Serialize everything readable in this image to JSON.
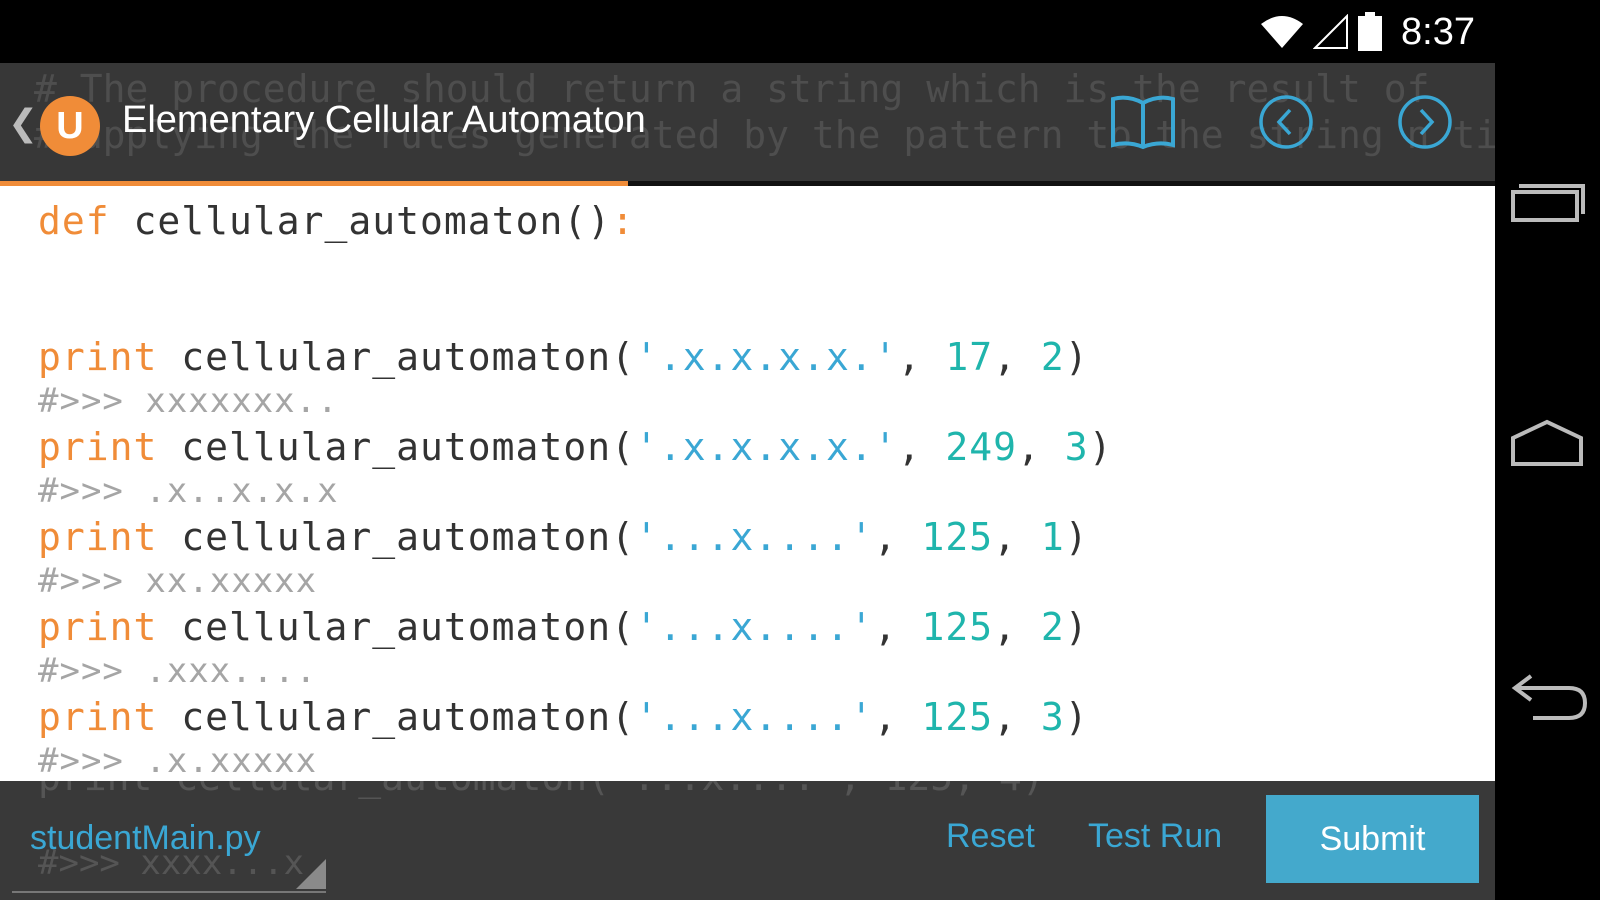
{
  "status_bar": {
    "time": "8:37"
  },
  "header": {
    "title": "Elementary Cellular Automaton",
    "logo_letter": "U",
    "ghost_lines": [
      "# The procedure should return a string which is the result of",
      "# applying the rules generated by the pattern to the string n tim"
    ],
    "progress_percent": 42
  },
  "code": {
    "def_line": {
      "kw": "def",
      "name": " cellular_automaton()",
      "colon": ":"
    },
    "calls": [
      {
        "str": "'.x.x.x.x.'",
        "n1": "17",
        "n2": "2",
        "result": "#>>> xxxxxxx.."
      },
      {
        "str": "'.x.x.x.x.'",
        "n1": "249",
        "n2": "3",
        "result": "#>>> .x..x.x.x"
      },
      {
        "str": "'...x....'",
        "n1": "125",
        "n2": "1",
        "result": "#>>> xx.xxxxx"
      },
      {
        "str": "'...x....'",
        "n1": "125",
        "n2": "2",
        "result": "#>>> .xxx...."
      },
      {
        "str": "'...x....'",
        "n1": "125",
        "n2": "3",
        "result": "#>>> .x.xxxxx"
      },
      {
        "str": "'...x....'",
        "n1": "125",
        "n2": "4",
        "result": "#>>> xxxx...x"
      }
    ],
    "print_kw": "print",
    "fn_name": " cellular_automaton(",
    "comma": ", ",
    "close": ")"
  },
  "toolbar": {
    "file_name": "studentMain.py",
    "reset_label": "Reset",
    "test_run_label": "Test Run",
    "submit_label": "Submit"
  },
  "colors": {
    "accent_orange": "#f08c38",
    "accent_blue": "#3aa7d4",
    "submit_bg": "#44a9cc"
  }
}
